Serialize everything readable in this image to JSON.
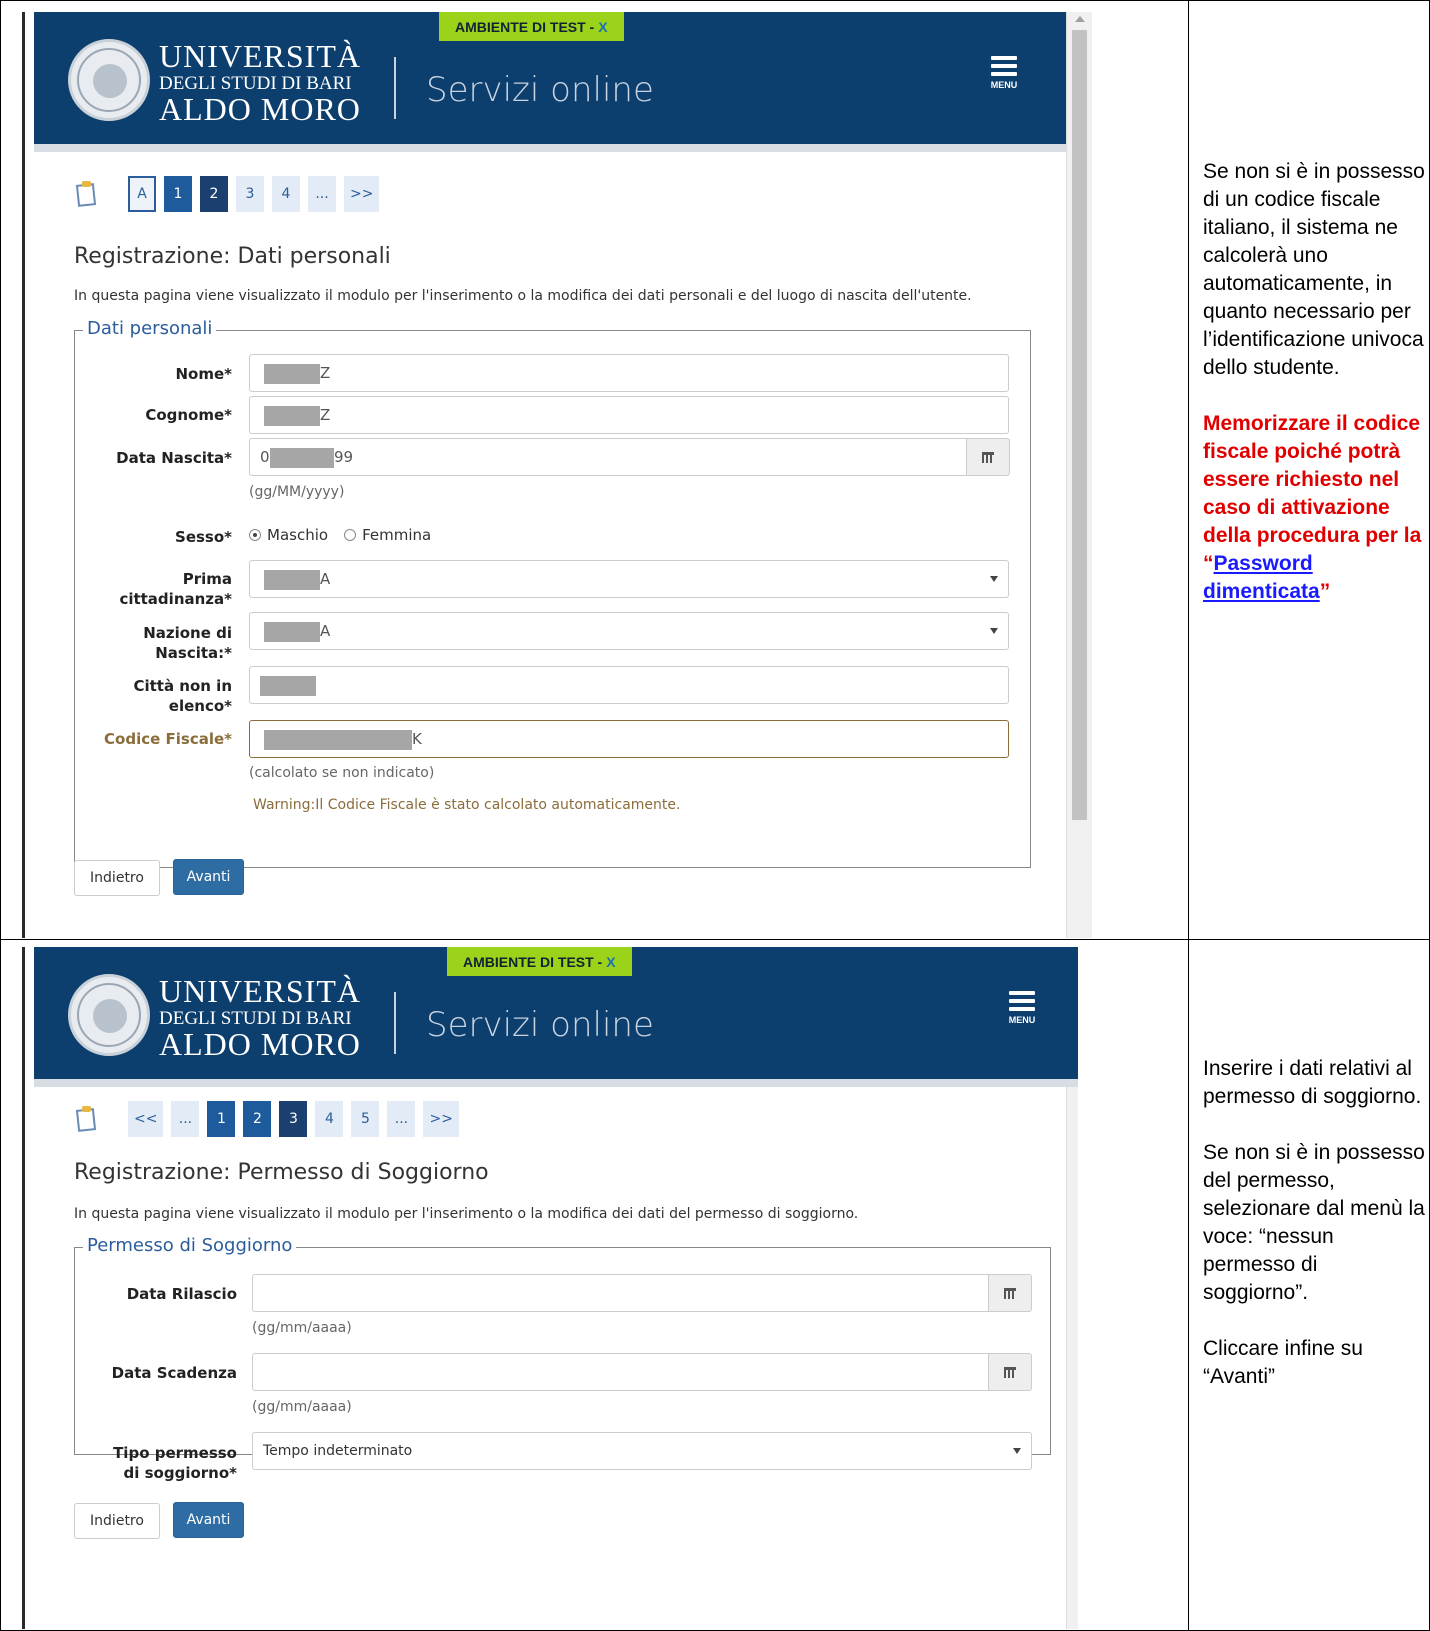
{
  "panel1": {
    "banner": "AMBIENTE DI TEST -",
    "banner_x": "X",
    "uni_line1": "UNIVERSITÀ",
    "uni_line2": "DEGLI STUDI DI BARI",
    "uni_line3": "ALDO MORO",
    "servizi": "Servizi online",
    "menu": "MENU",
    "steps": [
      "A",
      "1",
      "2",
      "3",
      "4",
      "...",
      ">>"
    ],
    "title": "Registrazione: Dati personali",
    "desc": "In questa pagina viene visualizzato il modulo per l'inserimento o la modifica dei dati personali e del luogo di nascita dell'utente.",
    "legend": "Dati personali",
    "fields": {
      "nome": {
        "label": "Nome*",
        "suffix": "Z"
      },
      "cognome": {
        "label": "Cognome*",
        "suffix": "Z"
      },
      "nascita": {
        "label": "Data Nascita*",
        "prefix": "0",
        "suffix": "99",
        "hint": "(gg/MM/yyyy)"
      },
      "sesso": {
        "label": "Sesso*",
        "opt1": "Maschio",
        "opt2": "Femmina"
      },
      "cittadinanza": {
        "label1": "Prima",
        "label2": "cittadinanza*",
        "suffix": "A"
      },
      "nazione": {
        "label1": "Nazione di",
        "label2": "Nascita:*",
        "suffix": "A"
      },
      "citta": {
        "label1": "Città non in",
        "label2": "elenco*"
      },
      "cf": {
        "label": "Codice Fiscale*",
        "suffix": "K",
        "hint": "(calcolato se non indicato)",
        "warning": "Warning:Il Codice Fiscale è stato calcolato automaticamente."
      }
    },
    "back": "Indietro",
    "next": "Avanti"
  },
  "panel2": {
    "banner": "AMBIENTE DI TEST -",
    "banner_x": "X",
    "uni_line1": "UNIVERSITÀ",
    "uni_line2": "DEGLI STUDI DI BARI",
    "uni_line3": "ALDO MORO",
    "servizi": "Servizi online",
    "menu": "MENU",
    "steps": [
      "<<",
      "...",
      "1",
      "2",
      "3",
      "4",
      "5",
      "...",
      ">>"
    ],
    "title": "Registrazione: Permesso di Soggiorno",
    "desc": "In questa pagina viene visualizzato il modulo per l'inserimento o la modifica dei dati del permesso di soggiorno.",
    "legend": "Permesso di Soggiorno",
    "fields": {
      "rilascio": {
        "label": "Data Rilascio",
        "hint": "(gg/mm/aaaa)"
      },
      "scadenza": {
        "label": "Data Scadenza",
        "hint": "(gg/mm/aaaa)"
      },
      "tipo": {
        "label1": "Tipo permesso",
        "label2": "di soggiorno*",
        "value": "Tempo indeterminato"
      }
    },
    "back": "Indietro",
    "next": "Avanti"
  },
  "notes": {
    "n1_p1": "Se non si è in possesso di un codice fiscale italiano, il sistema ne calcolerà uno automaticamente, in quanto necessario per l’identificazione univoca dello studente.",
    "n1_p2": "Memorizzare il codice fiscale poiché potrà essere richiesto nel caso di attivazione della procedura per la",
    "n1_open": "“",
    "n1_link": "Password dimenticata",
    "n1_close": "”",
    "n2_p1": "Inserire i dati relativi al permesso di soggiorno.",
    "n2_p2": "Se non si è in possesso del permesso, selezionare dal menù la voce: “nessun permesso di soggiorno”.",
    "n2_p3": "Cliccare infine su “Avanti”"
  },
  "colors": {
    "header": "#0c3e6e",
    "banner": "#9bd31a",
    "primary": "#2e6da4",
    "note_red": "#e00000",
    "link": "#1a1aff"
  }
}
